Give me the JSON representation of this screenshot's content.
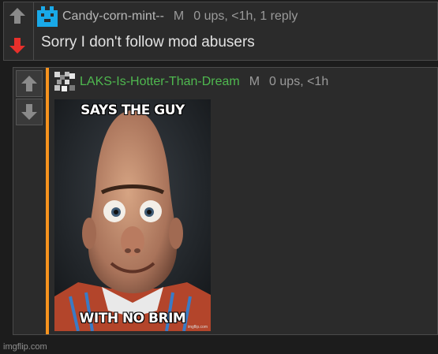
{
  "top_comment": {
    "username": "Candy-corn-mint--",
    "mod_badge": "M",
    "meta": "0 ups, <1h, 1 reply",
    "text": "Sorry I don't follow mod abusers",
    "downvote_active": true,
    "avatar_color": "#19a9e8"
  },
  "reply_comment": {
    "username": "LAKS-Is-Hotter-Than-Dream",
    "mod_badge": "M",
    "meta": "0 ups, <1h",
    "username_color": "#4fb84f",
    "accent_bar_color": "#f7931e",
    "image": {
      "caption_top": "SAYS THE GUY",
      "caption_bottom": "WITH NO BRIM",
      "watermark": "imgflip.com"
    }
  },
  "footer": {
    "watermark": "imgflip.com"
  },
  "icons": {
    "upvote": "arrow-up-icon",
    "downvote": "arrow-down-icon",
    "avatar_top": "pixel-avatar-icon",
    "avatar_reply": "pixel-avatar-icon"
  }
}
